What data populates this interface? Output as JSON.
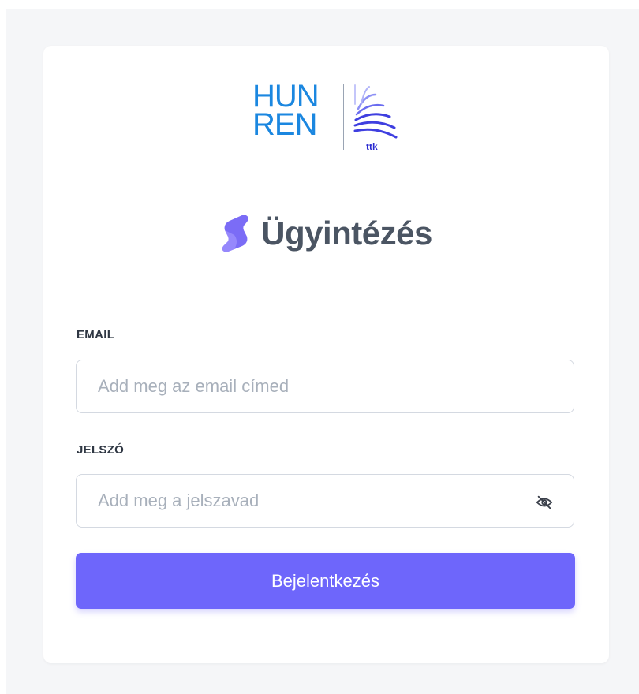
{
  "logo": {
    "line1": "HUN",
    "line2": "REN",
    "sub": "ttk"
  },
  "brand": {
    "title": "Ügyintézés",
    "icon": "s-logo-icon"
  },
  "form": {
    "email": {
      "label": "EMAIL",
      "placeholder": "Add meg az email címed",
      "value": ""
    },
    "password": {
      "label": "JELSZÓ",
      "placeholder": "Add meg a jelszavad",
      "value": "",
      "toggle_icon": "eye-off-icon"
    },
    "submit_label": "Bejelentkezés"
  },
  "colors": {
    "primary": "#6e66fb",
    "logo_blue": "#1b87e0",
    "logo_mark": "#3f3fe0",
    "brand_text": "#4b5563",
    "page_bg": "#f5f6f8"
  }
}
